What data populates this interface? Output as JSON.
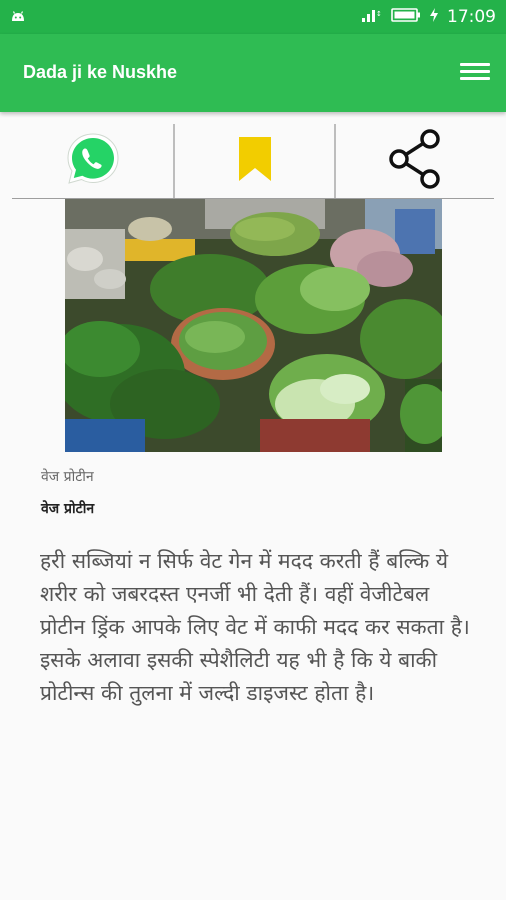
{
  "status": {
    "time": "17:09",
    "icons": [
      "android-icon",
      "signal-icon",
      "battery-icon",
      "charging-icon"
    ]
  },
  "app": {
    "title": "Dada ji ke Nuskhe",
    "primary_color": "#2fbc53",
    "status_color": "#24b24a"
  },
  "actions": [
    "whatsapp-icon",
    "bookmark-icon",
    "share-icon"
  ],
  "article": {
    "caption_small": "वेज प्रोटीन",
    "caption_bold": "वेज प्रोटीन",
    "body": "हरी सब्जियां न सिर्फ वेट गेन में मदद करती हैं बल्कि ये शरीर को जबरदस्त एनर्जी भी देती हैं। वहीं वेजीटेबल प्रोटीन ड्रिंक आपके लिए वेट में काफी मदद कर सकता है। इसके अलावा इसकी स्पेशैलिटी यह भी है कि ये बाकी प्रोटीन्स की तुलना में जल्दी डाइजस्ट होता है।"
  }
}
